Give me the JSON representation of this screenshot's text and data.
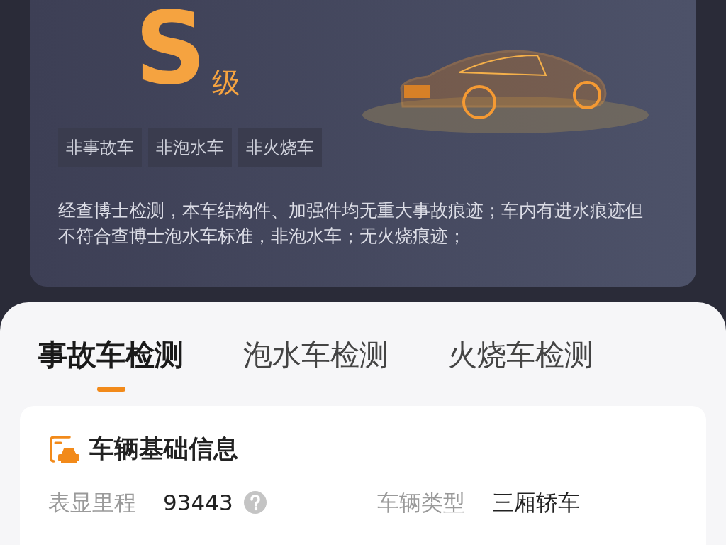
{
  "report": {
    "grade": "S",
    "grade_suffix": "级",
    "tags": [
      "非事故车",
      "非泡水车",
      "非火烧车"
    ],
    "description": "经查博士检测，本车结构件、加强件均无重大事故痕迹；车内有进水痕迹但不符合查博士泡水车标准，非泡水车；无火烧痕迹；"
  },
  "tabs": [
    {
      "label": "事故车检测",
      "selected": true
    },
    {
      "label": "泡水车检测",
      "selected": false
    },
    {
      "label": "火烧车检测",
      "selected": false
    }
  ],
  "section": {
    "title": "车辆基础信息",
    "fields": [
      {
        "label": "表显里程",
        "value": "93443",
        "help": true
      },
      {
        "label": "车辆类型",
        "value": "三厢轿车",
        "help": false
      }
    ]
  }
}
